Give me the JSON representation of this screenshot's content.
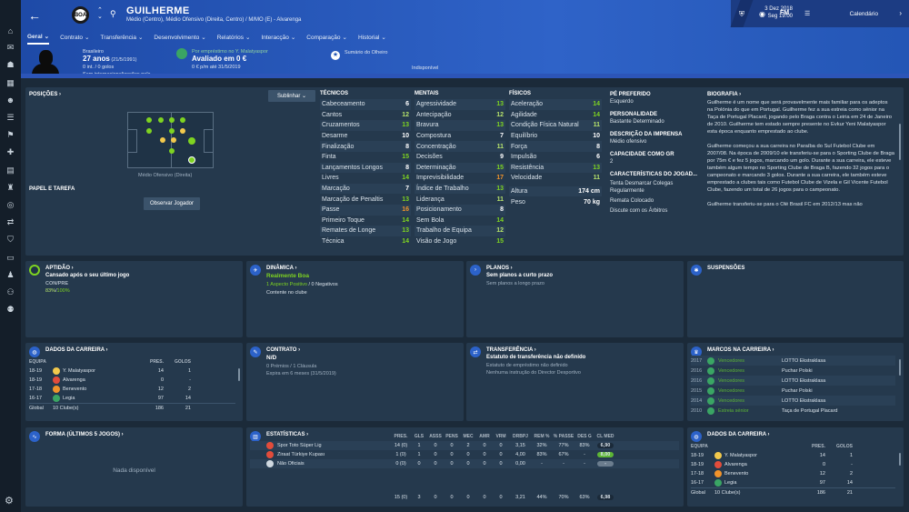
{
  "header": {
    "player_name": "GUILHERME",
    "player_sub": "Médio (Centro), Médio Ofensivo (Direita, Centro) / M/MO (E) - Alvarenga",
    "date": "3 Dez 2018",
    "day_time": "Seg 19:00",
    "calendar_label": "Calendário",
    "fm_label": "FM",
    "club_badge_text": "BOA"
  },
  "tabs": [
    {
      "label": "Geral"
    },
    {
      "label": "Contrato"
    },
    {
      "label": "Transferência"
    },
    {
      "label": "Desenvolvimento"
    },
    {
      "label": "Relatórios"
    },
    {
      "label": "Interacção"
    },
    {
      "label": "Comparação"
    },
    {
      "label": "Historial"
    }
  ],
  "info": {
    "nationality": "Brasileiro",
    "age": "27 anos",
    "dob": "(21/5/1991)",
    "intl": "0 int. / 0 golos",
    "intl_note": "Sem internacionalizações pela...",
    "loan_from": "Por empréstimo no Y. Malatyaspor",
    "value": "Avaliado em 0 €",
    "wage": "0 € p/m até 31/5/2019",
    "wage_dash": "-",
    "scout_label": "Sumário do Olheiro",
    "scout_value": "Indisponível"
  },
  "positions": {
    "title": "POSIÇÕES",
    "subscribe_btn": "Sublinhar",
    "role": "Médio Ofensivo (Direita)",
    "papel_title": "PAPEL E TAREFA",
    "observe_btn": "Observar Jogador"
  },
  "technical": {
    "title": "TÉCNICOS",
    "rows": [
      {
        "label": "Cabeceamento",
        "value": "6"
      },
      {
        "label": "Cantos",
        "value": "12"
      },
      {
        "label": "Cruzamentos",
        "value": "13"
      },
      {
        "label": "Desarme",
        "value": "10"
      },
      {
        "label": "Finalização",
        "value": "8"
      },
      {
        "label": "Finta",
        "value": "15"
      },
      {
        "label": "Lançamentos Longos",
        "value": "8"
      },
      {
        "label": "Livres",
        "value": "14"
      },
      {
        "label": "Marcação",
        "value": "7"
      },
      {
        "label": "Marcação de Penaltis",
        "value": "13"
      },
      {
        "label": "Passe",
        "value": "16"
      },
      {
        "label": "Primeiro Toque",
        "value": "14"
      },
      {
        "label": "Remates de Longe",
        "value": "13"
      },
      {
        "label": "Técnica",
        "value": "14"
      }
    ]
  },
  "mental": {
    "title": "MENTAIS",
    "rows": [
      {
        "label": "Agressividade",
        "value": "13"
      },
      {
        "label": "Antecipação",
        "value": "12"
      },
      {
        "label": "Bravura",
        "value": "13"
      },
      {
        "label": "Compostura",
        "value": "7"
      },
      {
        "label": "Concentração",
        "value": "11"
      },
      {
        "label": "Decisões",
        "value": "9"
      },
      {
        "label": "Determinação",
        "value": "15"
      },
      {
        "label": "Imprevisibilidade",
        "value": "17"
      },
      {
        "label": "Índice de Trabalho",
        "value": "13"
      },
      {
        "label": "Liderança",
        "value": "11"
      },
      {
        "label": "Posicionamento",
        "value": "8"
      },
      {
        "label": "Sem Bola",
        "value": "14"
      },
      {
        "label": "Trabalho de Equipa",
        "value": "12"
      },
      {
        "label": "Visão de Jogo",
        "value": "15"
      }
    ]
  },
  "physical": {
    "title": "FÍSICOS",
    "rows": [
      {
        "label": "Aceleração",
        "value": "14"
      },
      {
        "label": "Agilidade",
        "value": "14"
      },
      {
        "label": "Condição Física Natural",
        "value": "11"
      },
      {
        "label": "Equilíbrio",
        "value": "10"
      },
      {
        "label": "Força",
        "value": "8"
      },
      {
        "label": "Impulsão",
        "value": "6"
      },
      {
        "label": "Resistência",
        "value": "13"
      },
      {
        "label": "Velocidade",
        "value": "11"
      }
    ],
    "height_label": "Altura",
    "height": "174 cm",
    "weight_label": "Peso",
    "weight": "70 kg"
  },
  "profile": {
    "foot_label": "PÉ PREFERIDO",
    "foot": "Esquerdo",
    "personality_label": "PERSONALIDADE",
    "personality": "Bastante Determinado",
    "press_label": "DESCRIÇÃO DA IMPRENSA",
    "press": "Médio ofensivo",
    "gr_label": "CAPACIDADE COMO GR",
    "gr": "2",
    "traits_label": "CARACTERÍSTICAS DO JOGAD...",
    "traits": [
      "Tenta Desmarcar Colegas Regularmente",
      "Remata Colocado",
      "Discute com os Árbitros"
    ]
  },
  "bio": {
    "title": "BIOGRAFIA",
    "p1": "Guilherme é um nome que será provavelmente mais familiar para os adeptos na Polónia do que em Portugal. Guilherme fez a sua estreia como sénior na Taça de Portugal Placard, jogando pelo Braga contra o Leiria em 24 de Janeiro de 2010. Guilherme tem estado sempre presente no Evkur Yeni Malatyaspor esta época enquanto emprestado ao clube.",
    "p2": "Guilherme começou a sua carreira no Paraíba do Sul Futebol Clube em 2007/08. Na época de 2009/10 ele transferiu-se para o Sporting Clube de Braga por 75m € e fez 5 jogos, marcando um golo. Durante a sua carreira, ele esteve também algum tempo no Sporting Clube de Braga B, fazendo 32 jogos para o campeonato e marcando 3 golos. Durante a sua carreira, ele também esteve emprestado a clubes tais como Futebol Clube de Vizela e Gil Vicente Futebol Clube, fazendo um total de 26 jogos para o campeonato.",
    "p3": "Guilherme transferiu-se para o Olé Brasil FC em 2012/13 mas não"
  },
  "aptidao": {
    "title": "APTIDÃO",
    "line": "Cansado após o seu último jogo",
    "con_label": "CON/PRE",
    "con_val1": "83%",
    "con_sep": "/",
    "con_val2": "100%"
  },
  "dinamica": {
    "title": "DINÂMICA",
    "status": "Realmente Boa",
    "aspects_pos": "1 Aspecto Positivo",
    "aspects_sep": "/",
    "aspects_neg": "0 Negativos",
    "line": "Contente no clube"
  },
  "planos": {
    "title": "PLANOS",
    "line1": "Sem planos a curto prazo",
    "line2": "Sem planos a longo prazo"
  },
  "suspensoes": {
    "title": "SUSPENSÕES"
  },
  "career": {
    "title": "DADOS DA CARREIRA",
    "col_team": "EQUIPA",
    "col_apps": "PRES.",
    "col_goals": "GOLOS",
    "rows": [
      {
        "season": "18-19",
        "team": "Y. Malatyaspor",
        "apps": "14",
        "goals": "1"
      },
      {
        "season": "18-19",
        "team": "Alvarenga",
        "apps": "0",
        "goals": "-"
      },
      {
        "season": "17-18",
        "team": "Benevento",
        "apps": "12",
        "goals": "2"
      },
      {
        "season": "16-17",
        "team": "Legia",
        "apps": "97",
        "goals": "14"
      }
    ],
    "total_label": "Global",
    "total_clubs": "10 Clube(s)",
    "total_apps": "186",
    "total_goals": "21"
  },
  "contrato": {
    "title": "CONTRATO",
    "value": "N/D",
    "line1": "0 Prémios / 1 Cláusula",
    "line2": "Expira em 6 meses (31/5/2019)"
  },
  "transfer": {
    "title": "TRANSFERÊNCIA",
    "line1": "Estatuto de transferência não definido",
    "line2": "Estatuto de empréstimo não definido",
    "line3": "Nenhuma instrução do Director Desportivo"
  },
  "marcos": {
    "title": "MARCOS NA CARREIRA",
    "rows": [
      {
        "year": "2017",
        "tag": "Vencedores",
        "comp": "LOTTO Ekstraklasa"
      },
      {
        "year": "2016",
        "tag": "Vencedores",
        "comp": "Puchar Polski"
      },
      {
        "year": "2016",
        "tag": "Vencedores",
        "comp": "LOTTO Ekstraklasa"
      },
      {
        "year": "2015",
        "tag": "Vencedores",
        "comp": "Puchar Polski"
      },
      {
        "year": "2014",
        "tag": "Vencedores",
        "comp": "LOTTO Ekstraklasa"
      },
      {
        "year": "2010",
        "tag": "Estreia sénior",
        "comp": "Taça de Portugal Placard"
      }
    ]
  },
  "forma": {
    "title": "FORMA (ÚLTIMOS 5 JOGOS)",
    "empty": "Nada disponível"
  },
  "stats": {
    "title": "ESTATÍSTICAS",
    "headers": [
      "PRES.",
      "GLS",
      "ASSS",
      "PENS",
      "MEC",
      "AMR",
      "VRM",
      "DRBPJ",
      "REM %",
      "% PASSE",
      "DES G",
      "CL MED"
    ],
    "rows": [
      {
        "comp": "Spor Toto Süper Lig",
        "vals": [
          "14 (0)",
          "1",
          "0",
          "0",
          "2",
          "0",
          "0",
          "3,15",
          "32%",
          "77%",
          "83%"
        ],
        "rating": "6,90"
      },
      {
        "comp": "Ziraat Türkiye Kupası",
        "vals": [
          "1 (0)",
          "1",
          "0",
          "0",
          "0",
          "0",
          "0",
          "4,00",
          "83%",
          "67%",
          "-"
        ],
        "rating": "8,00"
      },
      {
        "comp": "Não Oficiais",
        "vals": [
          "0 (0)",
          "0",
          "0",
          "0",
          "0",
          "0",
          "0",
          "0,00",
          "-",
          "-",
          "-"
        ],
        "rating": "-"
      }
    ],
    "total": [
      "15 (0)",
      "3",
      "0",
      "0",
      "0",
      "0",
      "0",
      "3,21",
      "44%",
      "70%",
      "63%"
    ],
    "total_rating": "6,98"
  },
  "colors": {
    "accent": "#2c62c9",
    "green": "#7ed321",
    "yellow": "#f2c94c",
    "orange": "#f0932b",
    "panel": "#25394d"
  }
}
